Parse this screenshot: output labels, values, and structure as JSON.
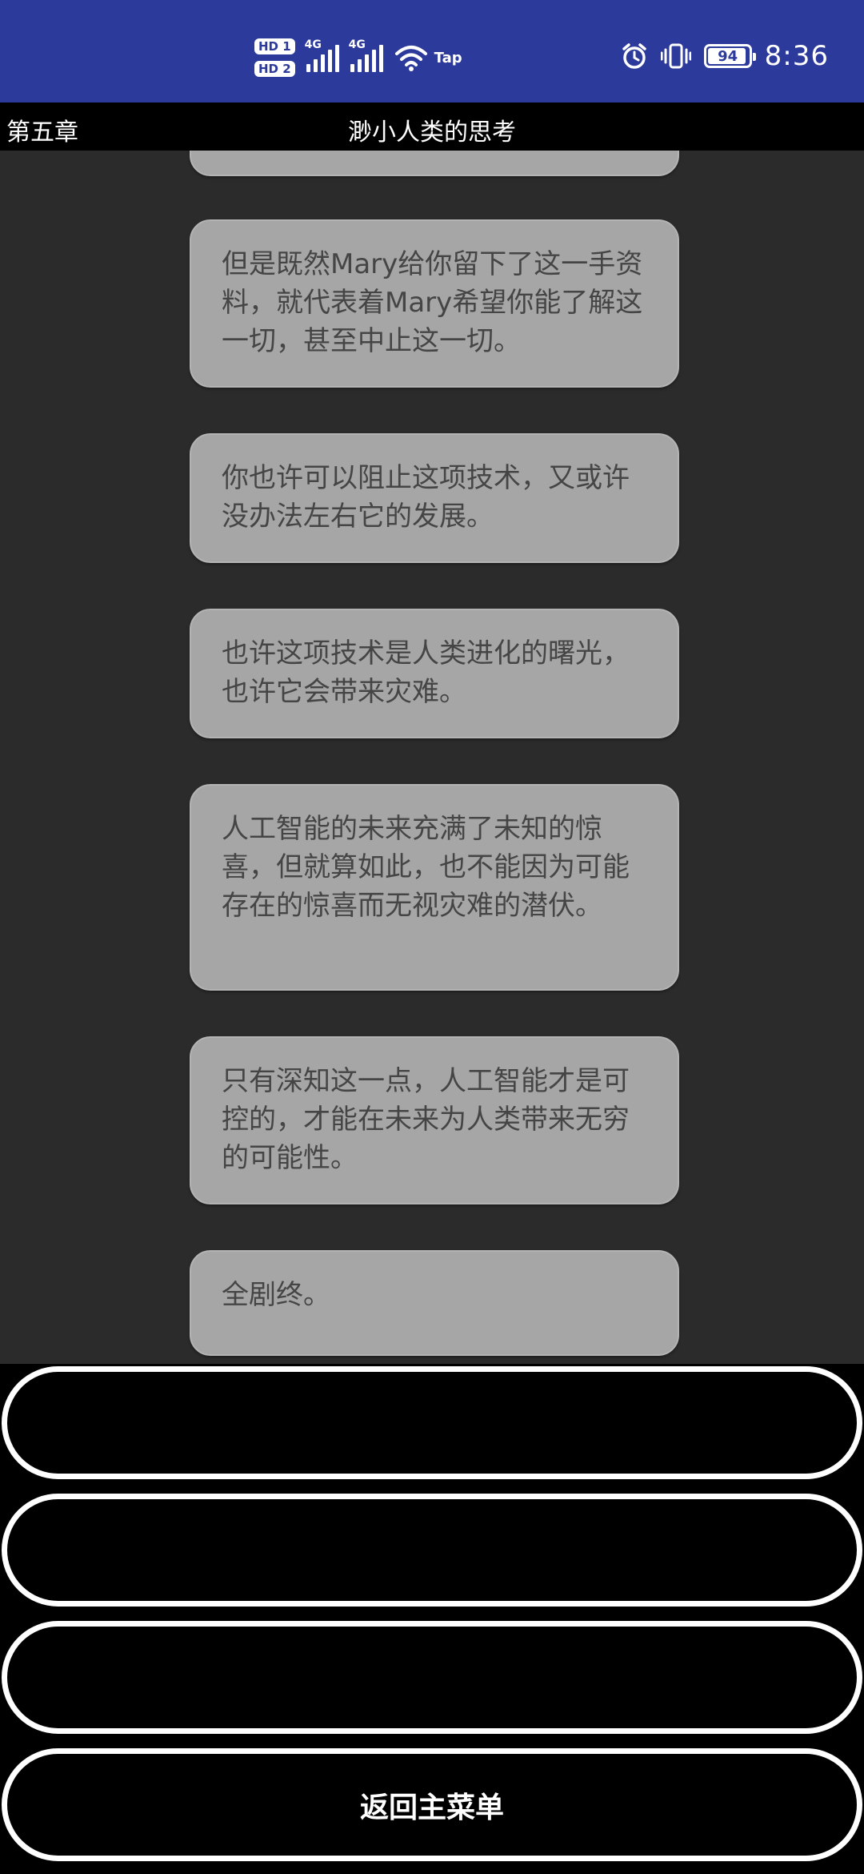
{
  "status_bar": {
    "sim1": "HD 1",
    "sim2": "HD 2",
    "network1": "4G",
    "network2": "4G",
    "wifi_extra": "Tap",
    "battery_level": 94,
    "battery_text": "94",
    "time": "8:36",
    "icons": [
      "alarm-icon",
      "vibrate-icon",
      "battery-icon",
      "wifi-icon",
      "signal-icon"
    ]
  },
  "header": {
    "chapter": "第五章",
    "title": "渺小人类的思考"
  },
  "dialog": {
    "bubbles": [
      "",
      "但是既然Mary给你留下了这一手资料，就代表着Mary希望你能了解这一切，甚至中止这一切。",
      "你也许可以阻止这项技术，又或许没办法左右它的发展。",
      "也许这项技术是人类进化的曙光，也许它会带来灾难。",
      "人工智能的未来充满了未知的惊喜，但就算如此，也不能因为可能存在的惊喜而无视灾难的潜伏。",
      "只有深知这一点，人工智能才是可控的，才能在未来为人类带来无穷的可能性。",
      "全剧终。"
    ]
  },
  "choices": {
    "buttons": [
      "",
      "",
      "",
      "返回主菜单"
    ]
  },
  "colors": {
    "status_bar": "#2c3b9b",
    "header": "#000000",
    "background": "#2b2b2b",
    "bubble": "#a6a6a6",
    "bubble_text": "#454545",
    "button_border": "#ffffff"
  }
}
